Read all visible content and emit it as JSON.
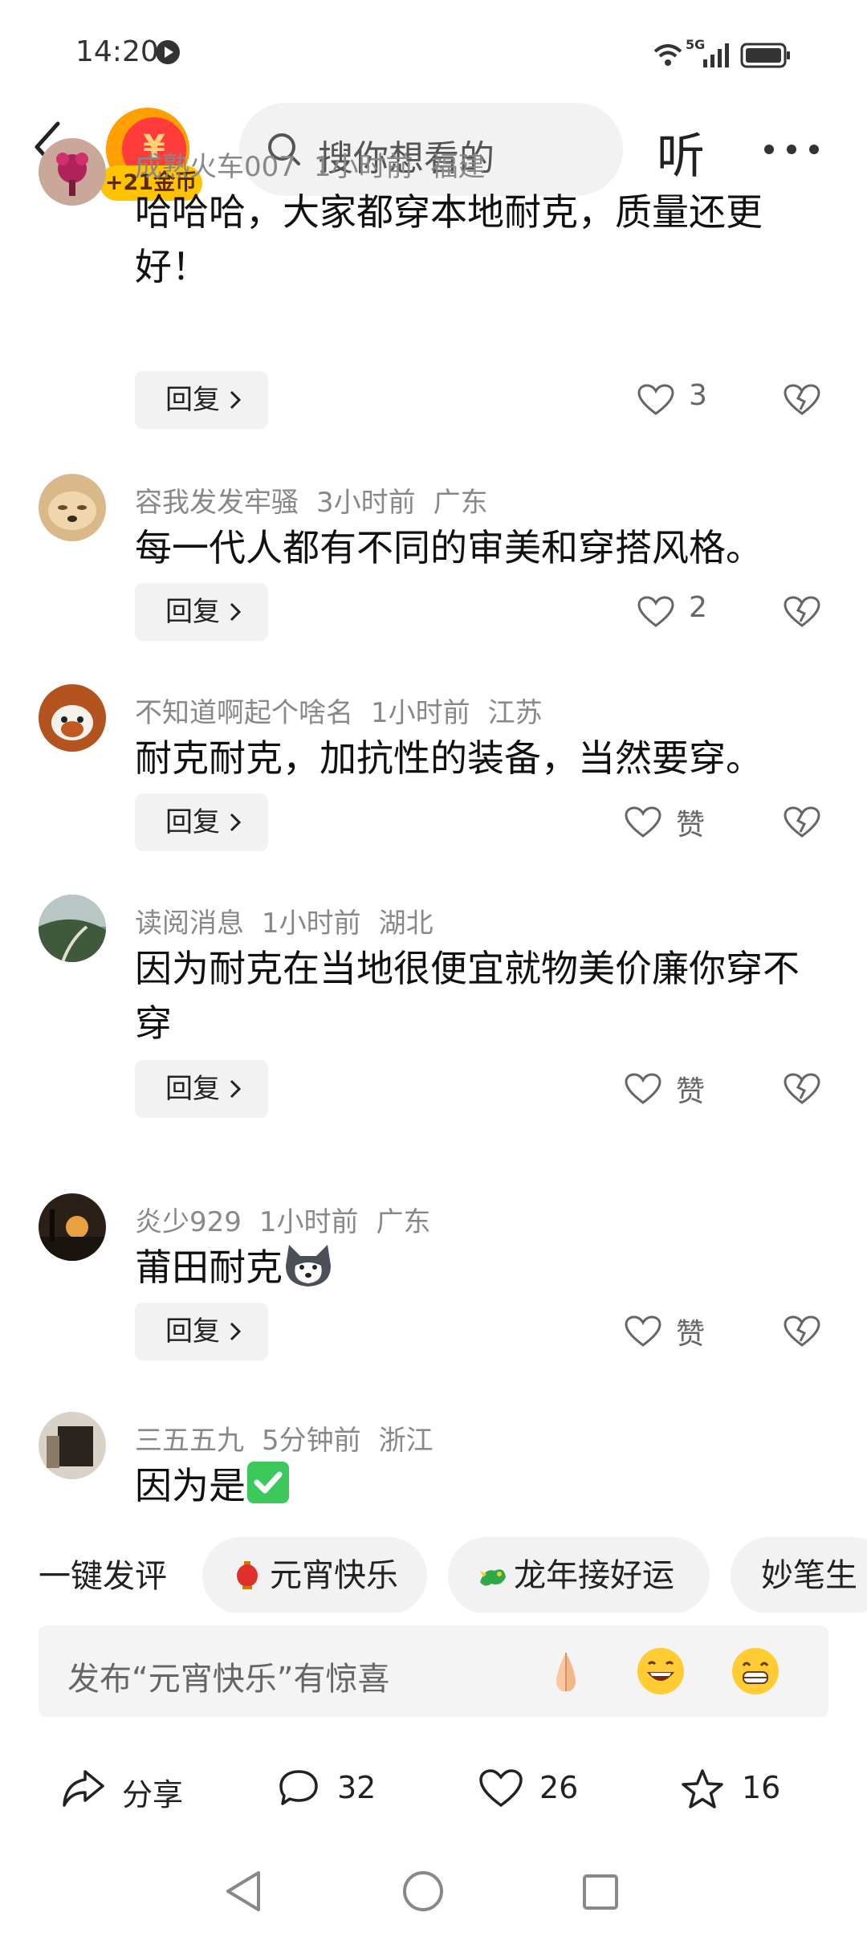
{
  "status_bar": {
    "time": "14:20",
    "network": "5G"
  },
  "header": {
    "coin_badge": "+21金币",
    "search_placeholder": "搜你想看的",
    "listen_label": "听"
  },
  "comments": [
    {
      "user": "成熟火车007",
      "time": "1小时前",
      "location": "福建",
      "text": "哈哈哈，大家都穿本地耐克，质量还更好！",
      "reply_label": "回复",
      "likes": "3"
    },
    {
      "user": "容我发发牢骚",
      "time": "3小时前",
      "location": "广东",
      "text": "每一代人都有不同的审美和穿搭风格。",
      "reply_label": "回复",
      "likes": "2"
    },
    {
      "user": "不知道啊起个啥名",
      "time": "1小时前",
      "location": "江苏",
      "text": "耐克耐克，加抗性的装备，当然要穿。",
      "reply_label": "回复",
      "likes": "赞"
    },
    {
      "user": "读阅消息",
      "time": "1小时前",
      "location": "湖北",
      "text": "因为耐克在当地很便宜就物美价廉你穿不穿",
      "reply_label": "回复",
      "likes": "赞"
    },
    {
      "user": "炎少929",
      "time": "1小时前",
      "location": "广东",
      "text": "莆田耐克",
      "reply_label": "回复",
      "likes": "赞"
    },
    {
      "user": "三五五九",
      "time": "5分钟前",
      "location": "浙江",
      "text": "因为是"
    }
  ],
  "quick_comment": {
    "label": "一键发评",
    "chips": [
      "元宵快乐",
      "龙年接好运",
      "妙笔生"
    ]
  },
  "input": {
    "placeholder": "发布“元宵快乐”有惊喜"
  },
  "actions": {
    "share_label": "分享",
    "comment_count": "32",
    "like_count": "26",
    "favorite_count": "16"
  },
  "colors": {
    "accent": "#ff9f00",
    "coin_badge": "#ffc400",
    "check_green": "#3cc85a"
  }
}
